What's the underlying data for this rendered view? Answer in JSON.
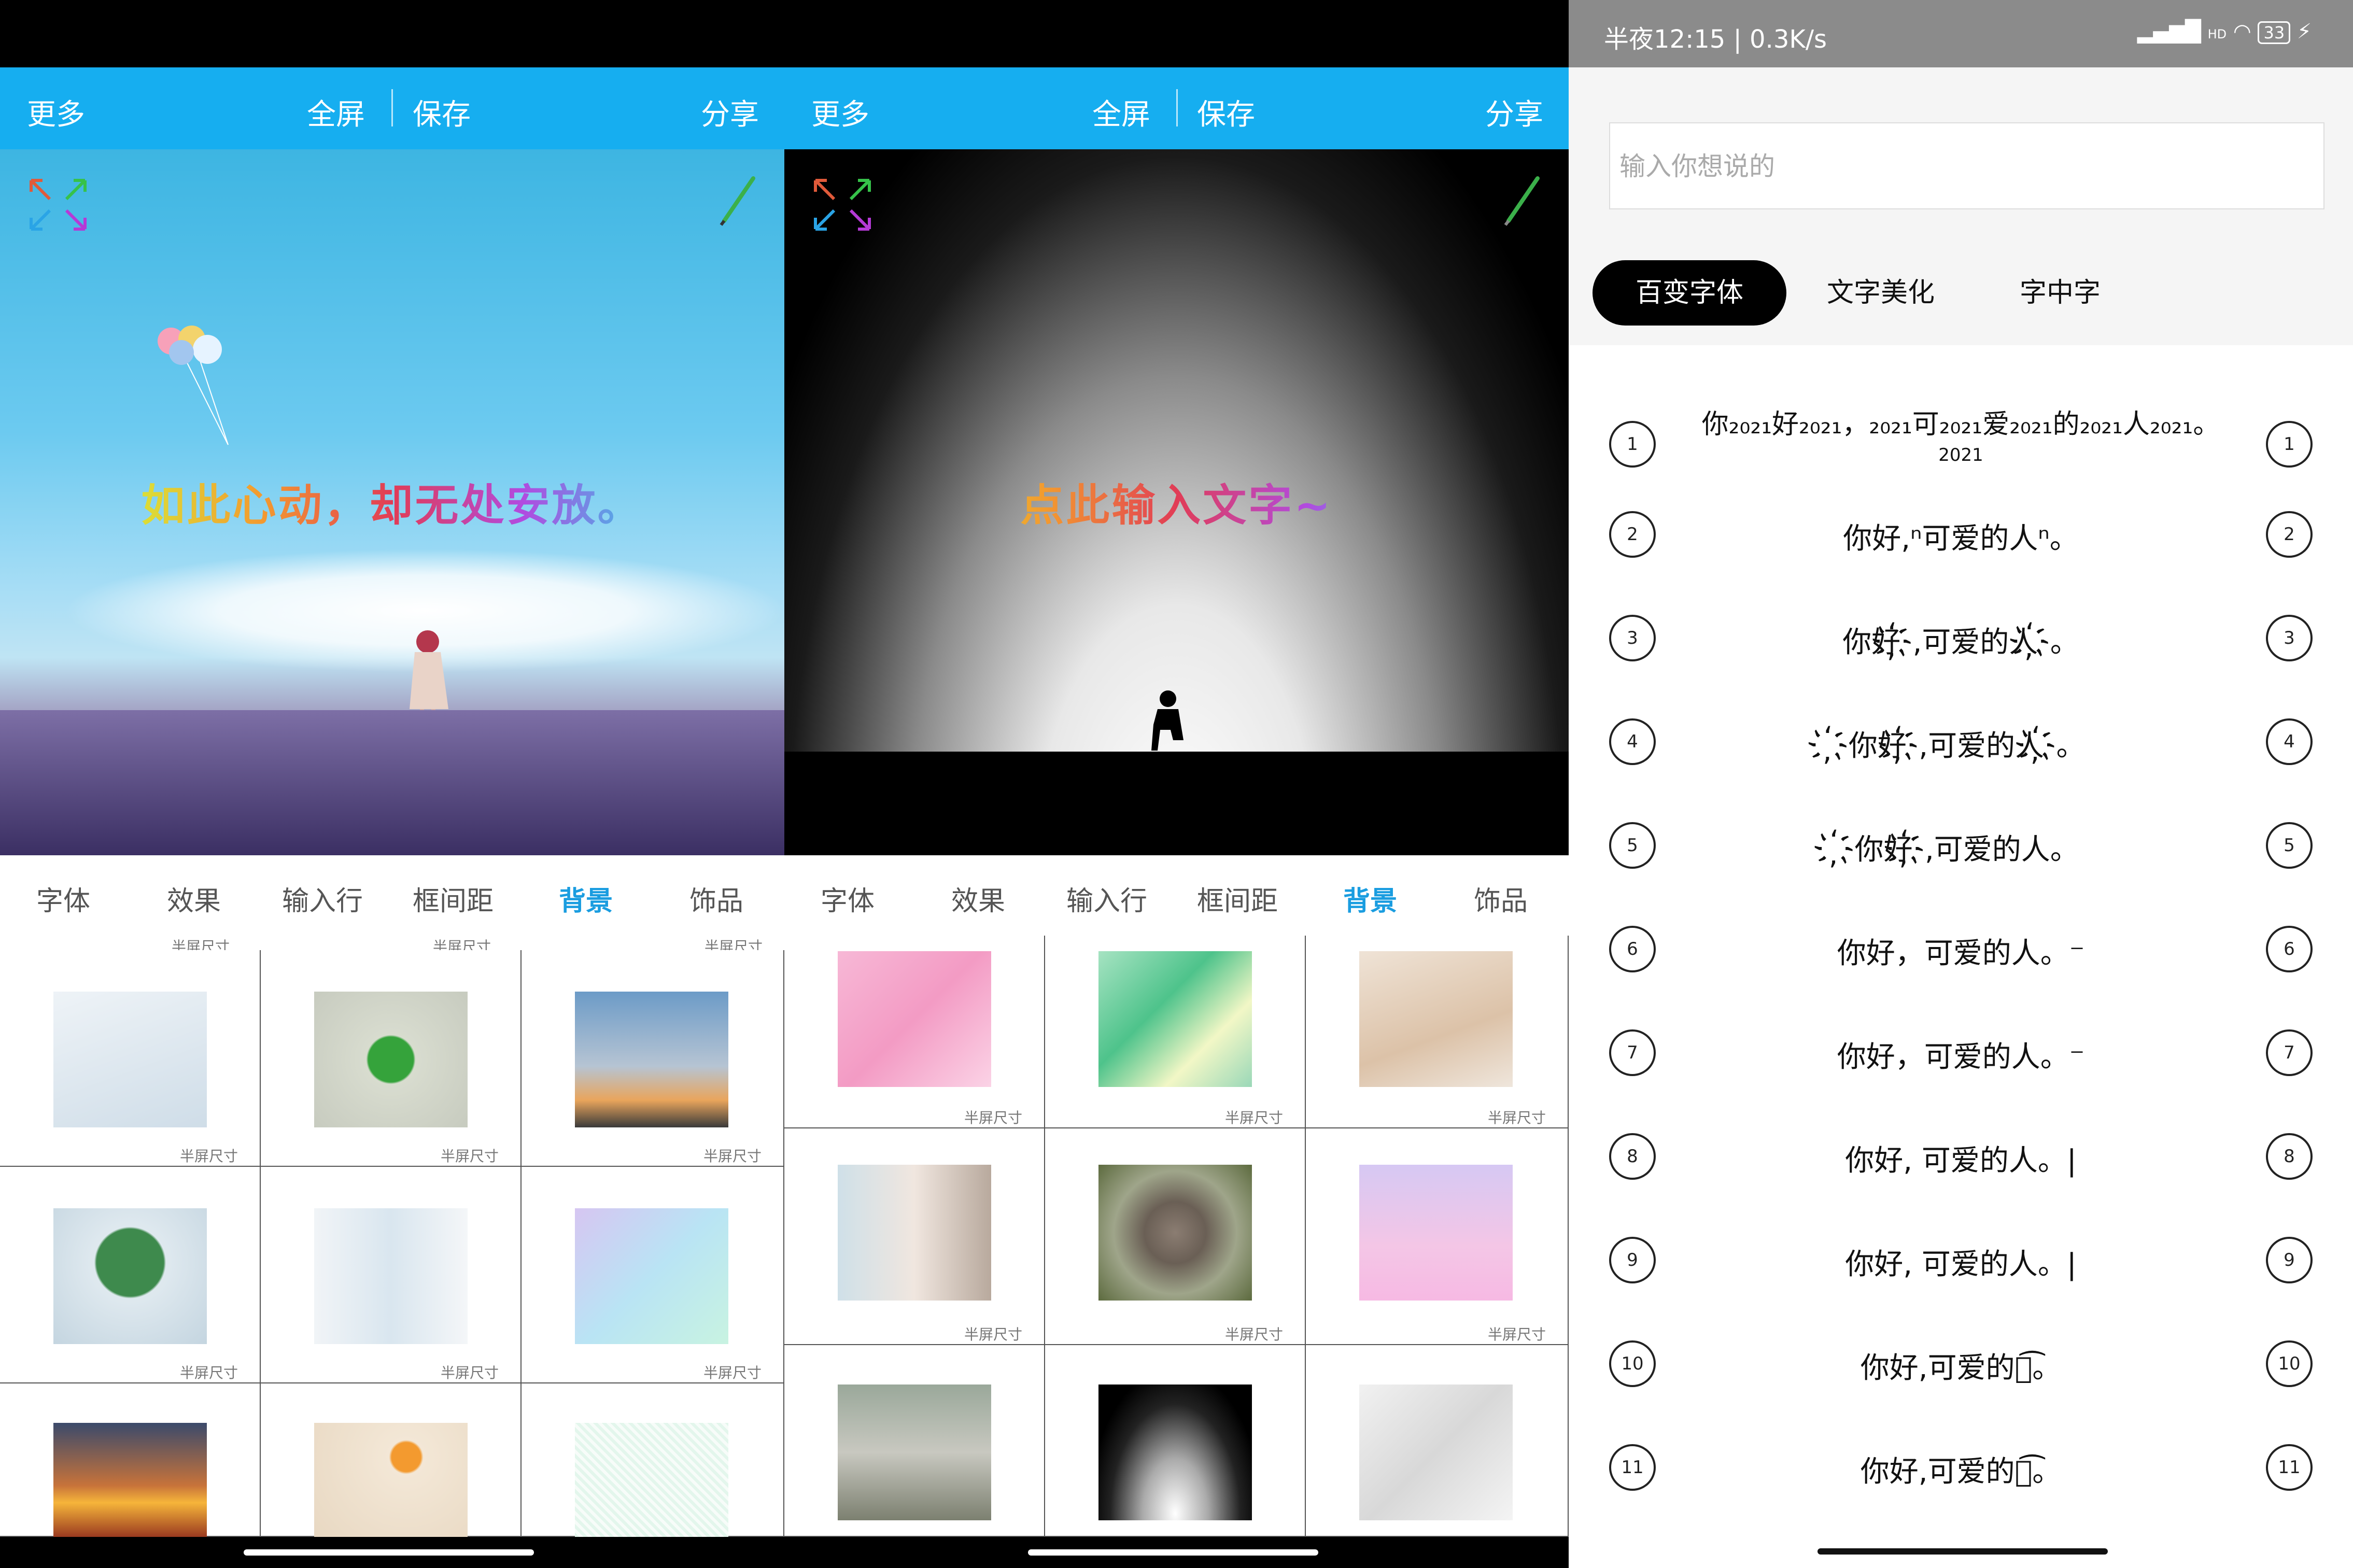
{
  "editor": {
    "toolbar": {
      "more": "更多",
      "fullscreen": "全屏",
      "save": "保存",
      "share": "分享"
    },
    "tabs": [
      "字体",
      "效果",
      "输入行",
      "框间距",
      "背景",
      "饰品"
    ],
    "active_tab": "背景",
    "thumb_caption": "半屏尺寸",
    "accent": "#16aef0"
  },
  "left": {
    "canvas_text": "如此心动，却无处安放。"
  },
  "middle": {
    "canvas_text": "点此输入文字~"
  },
  "right": {
    "status": {
      "time": "半夜12:15 | 0.3K/s",
      "signal": "HD",
      "battery": "33"
    },
    "input_placeholder": "输入你想说的",
    "segments": [
      "百变字体",
      "文字美化",
      "字中字"
    ],
    "rows": [
      {
        "n": "1",
        "text": "你₂₀₂₁好₂₀₂₁，₂₀₂₁可₂₀₂₁爱₂₀₂₁的₂₀₂₁人₂₀₂₁。",
        "sub": "2021"
      },
      {
        "n": "2",
        "text": "你好,ⁿ可爱的人ⁿ。"
      },
      {
        "n": "3",
        "text": "你好҉,可爱的人҉。"
      },
      {
        "n": "4",
        "text": "҉你好҉,可爱的人҉。"
      },
      {
        "n": "5",
        "text": "҉你好҉,可爱的人。"
      },
      {
        "n": "6",
        "text": "你好，可爱的人。⁻"
      },
      {
        "n": "7",
        "text": "你好，可爱的人。⁻"
      },
      {
        "n": "8",
        "text": "你好, 可爱的人。|"
      },
      {
        "n": "9",
        "text": "你好, 可爱的人。|"
      },
      {
        "n": "10",
        "text": "你好,可爱的人͡。"
      },
      {
        "n": "11",
        "text": "你好,可爱的人͡。"
      }
    ]
  }
}
